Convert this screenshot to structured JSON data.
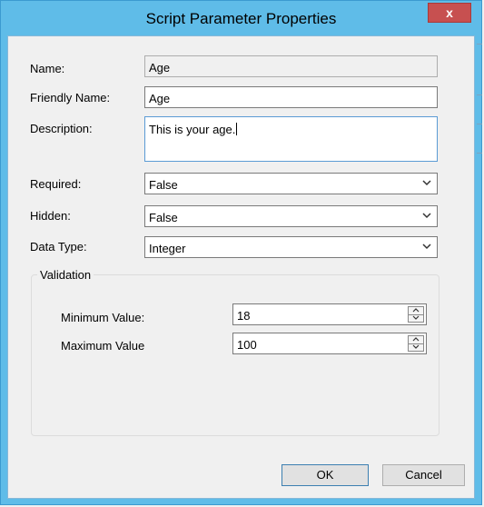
{
  "window": {
    "title": "Script Parameter Properties",
    "close_label": "x"
  },
  "form": {
    "name": {
      "label": "Name:",
      "value": "Age"
    },
    "friendly_name": {
      "label": "Friendly Name:",
      "value": "Age"
    },
    "description": {
      "label": "Description:",
      "value": "This is your age."
    },
    "required": {
      "label": "Required:",
      "value": "False"
    },
    "hidden": {
      "label": "Hidden:",
      "value": "False"
    },
    "data_type": {
      "label": "Data Type:",
      "value": "Integer"
    }
  },
  "validation": {
    "legend": "Validation",
    "min": {
      "label": "Minimum Value:",
      "value": "18"
    },
    "max": {
      "label": "Maximum Value",
      "value": "100"
    }
  },
  "buttons": {
    "ok": "OK",
    "cancel": "Cancel"
  },
  "colors": {
    "titlebar": "#5fbce8",
    "close": "#c75050",
    "dialog": "#f0f0f0"
  }
}
